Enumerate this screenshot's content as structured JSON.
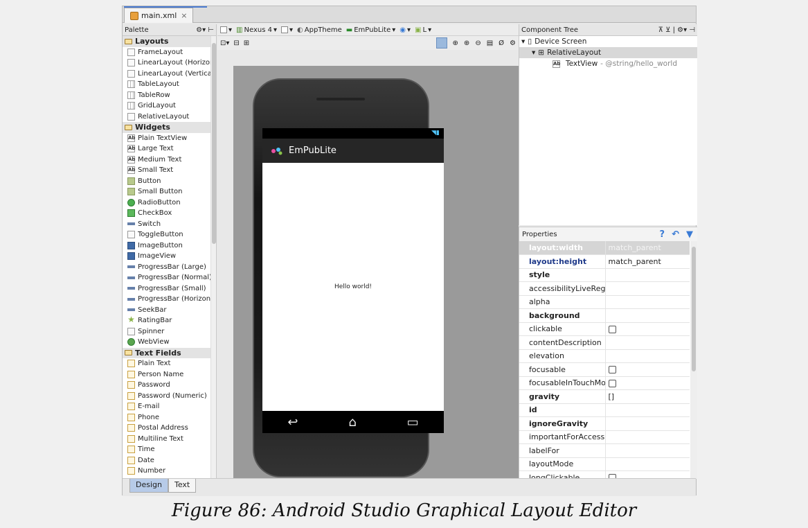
{
  "tab": {
    "filename": "main.xml",
    "close": "×"
  },
  "palette": {
    "title": "Palette",
    "sections": [
      {
        "name": "Layouts",
        "items": [
          "FrameLayout",
          "LinearLayout (Horizon",
          "LinearLayout (Vertica",
          "TableLayout",
          "TableRow",
          "GridLayout",
          "RelativeLayout"
        ]
      },
      {
        "name": "Widgets",
        "items": [
          "Plain TextView",
          "Large Text",
          "Medium Text",
          "Small Text",
          "Button",
          "Small Button",
          "RadioButton",
          "CheckBox",
          "Switch",
          "ToggleButton",
          "ImageButton",
          "ImageView",
          "ProgressBar (Large)",
          "ProgressBar (Normal)",
          "ProgressBar (Small)",
          "ProgressBar (Horizon",
          "SeekBar",
          "RatingBar",
          "Spinner",
          "WebView"
        ]
      },
      {
        "name": "Text Fields",
        "items": [
          "Plain Text",
          "Person Name",
          "Password",
          "Password (Numeric)",
          "E-mail",
          "Phone",
          "Postal Address",
          "Multiline Text",
          "Time",
          "Date",
          "Number"
        ]
      }
    ]
  },
  "toolbar": {
    "device": "Nexus 4",
    "theme": "AppTheme",
    "activity": "EmPubLite",
    "api": "L"
  },
  "preview": {
    "app_title": "EmPubLite",
    "content": "Hello world!"
  },
  "component_tree": {
    "title": "Component Tree",
    "nodes": [
      {
        "label": "Device Screen"
      },
      {
        "label": "RelativeLayout"
      },
      {
        "label": "TextView",
        "detail": " - @string/hello_world"
      }
    ]
  },
  "properties": {
    "title": "Properties",
    "rows": [
      {
        "name": "layout:width",
        "value": "match_parent"
      },
      {
        "name": "layout:height",
        "value": "match_parent"
      },
      {
        "name": "style",
        "value": ""
      },
      {
        "name": "accessibilityLiveRegic",
        "value": ""
      },
      {
        "name": "alpha",
        "value": ""
      },
      {
        "name": "background",
        "value": ""
      },
      {
        "name": "clickable",
        "value": ""
      },
      {
        "name": "contentDescription",
        "value": ""
      },
      {
        "name": "elevation",
        "value": ""
      },
      {
        "name": "focusable",
        "value": ""
      },
      {
        "name": "focusableInTouchMo",
        "value": ""
      },
      {
        "name": "gravity",
        "value": "[]"
      },
      {
        "name": "id",
        "value": ""
      },
      {
        "name": "ignoreGravity",
        "value": ""
      },
      {
        "name": "importantForAccessit",
        "value": ""
      },
      {
        "name": "labelFor",
        "value": ""
      },
      {
        "name": "layoutMode",
        "value": ""
      },
      {
        "name": "longClickable",
        "value": ""
      }
    ]
  },
  "bottom_tabs": {
    "design": "Design",
    "text": "Text"
  },
  "caption": "Figure 86: Android Studio Graphical Layout Editor"
}
